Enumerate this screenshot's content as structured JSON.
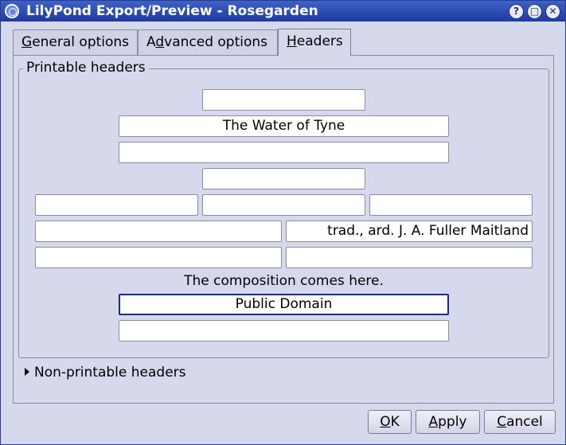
{
  "window": {
    "title": "LilyPond Export/Preview - Rosegarden",
    "controls": [
      "help-icon",
      "maximize-icon",
      "close-icon"
    ]
  },
  "tabs": [
    {
      "pre": "",
      "mn": "G",
      "post": "eneral options"
    },
    {
      "pre": "A",
      "mn": "d",
      "post": "vanced options"
    },
    {
      "pre": "",
      "mn": "H",
      "post": "eaders"
    }
  ],
  "printable_headers": {
    "label": "Printable headers",
    "dedication": "",
    "title": "The Water of Tyne",
    "subtitle": "",
    "subsubtitle": "",
    "poet": "",
    "instrument": "",
    "composer_left": "",
    "meter": "",
    "composer": "trad., ard. J. A. Fuller Maitland",
    "opus": "",
    "arranger": "",
    "composition_placeholder": "The composition comes here.",
    "copyright": "Public Domain",
    "tagline": ""
  },
  "non_printable": {
    "label": "Non-printable headers"
  },
  "buttons": {
    "ok": {
      "pre": "",
      "mn": "O",
      "post": "K"
    },
    "apply": {
      "pre": "",
      "mn": "A",
      "post": "pply"
    },
    "cancel": {
      "pre": "",
      "mn": "C",
      "post": "ancel"
    }
  }
}
